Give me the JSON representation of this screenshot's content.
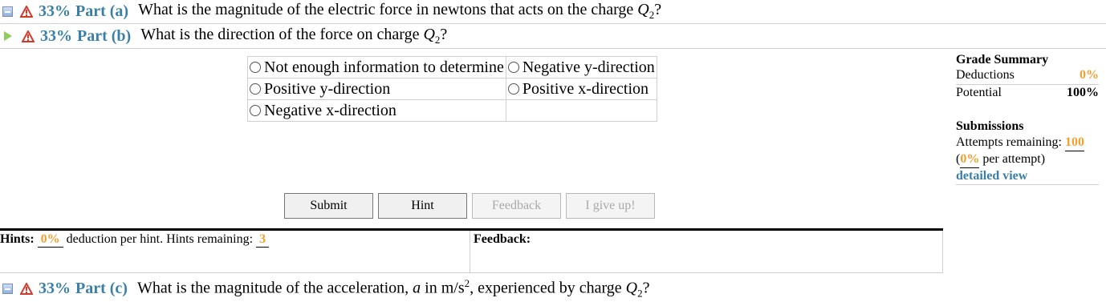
{
  "part_a": {
    "percent": "33%",
    "label": "Part (a)",
    "question": "What is the magnitude of the electric force in newtons that acts on the charge",
    "symbol": "Q",
    "subscript": "2",
    "tail": "?"
  },
  "part_b": {
    "percent": "33%",
    "label": "Part (b)",
    "question": "What is the direction of the force on charge",
    "symbol": "Q",
    "subscript": "2",
    "tail": "?"
  },
  "part_c": {
    "percent": "33%",
    "label": "Part (c)",
    "question_pre": "What is the magnitude of the acceleration,",
    "symbol_a": "a",
    "question_mid": "in m/s",
    "superscript": "2",
    "question_post": ", experienced by charge",
    "symbol": "Q",
    "subscript": "2",
    "tail": "?"
  },
  "options": [
    [
      "Not enough information to determine",
      "Negative y-direction"
    ],
    [
      "Positive y-direction",
      "Positive x-direction"
    ],
    [
      "Negative x-direction",
      ""
    ]
  ],
  "buttons": {
    "submit": "Submit",
    "hint": "Hint",
    "feedback": "Feedback",
    "give_up": "I give up!"
  },
  "hints": {
    "label": "Hints:",
    "deduction": "0%",
    "text": "deduction per hint. Hints remaining:",
    "remaining": "3"
  },
  "feedback": {
    "label": "Feedback:"
  },
  "grade_summary": {
    "title": "Grade Summary",
    "deductions_label": "Deductions",
    "deductions_value": "0%",
    "potential_label": "Potential",
    "potential_value": "100%"
  },
  "submissions": {
    "title": "Submissions",
    "attempts_label": "Attempts remaining:",
    "attempts_value": "100",
    "per_attempt_open": "(",
    "per_attempt_value": "0%",
    "per_attempt_text": "per attempt)",
    "detail_link": "detailed view"
  },
  "colors": {
    "accent": "#3a7fa6",
    "highlight": "#f0a030",
    "play": "#8ccf5a",
    "warn": "#d33a2c"
  },
  "icons": [
    "collapse-icon",
    "warning-icon",
    "play-icon"
  ]
}
